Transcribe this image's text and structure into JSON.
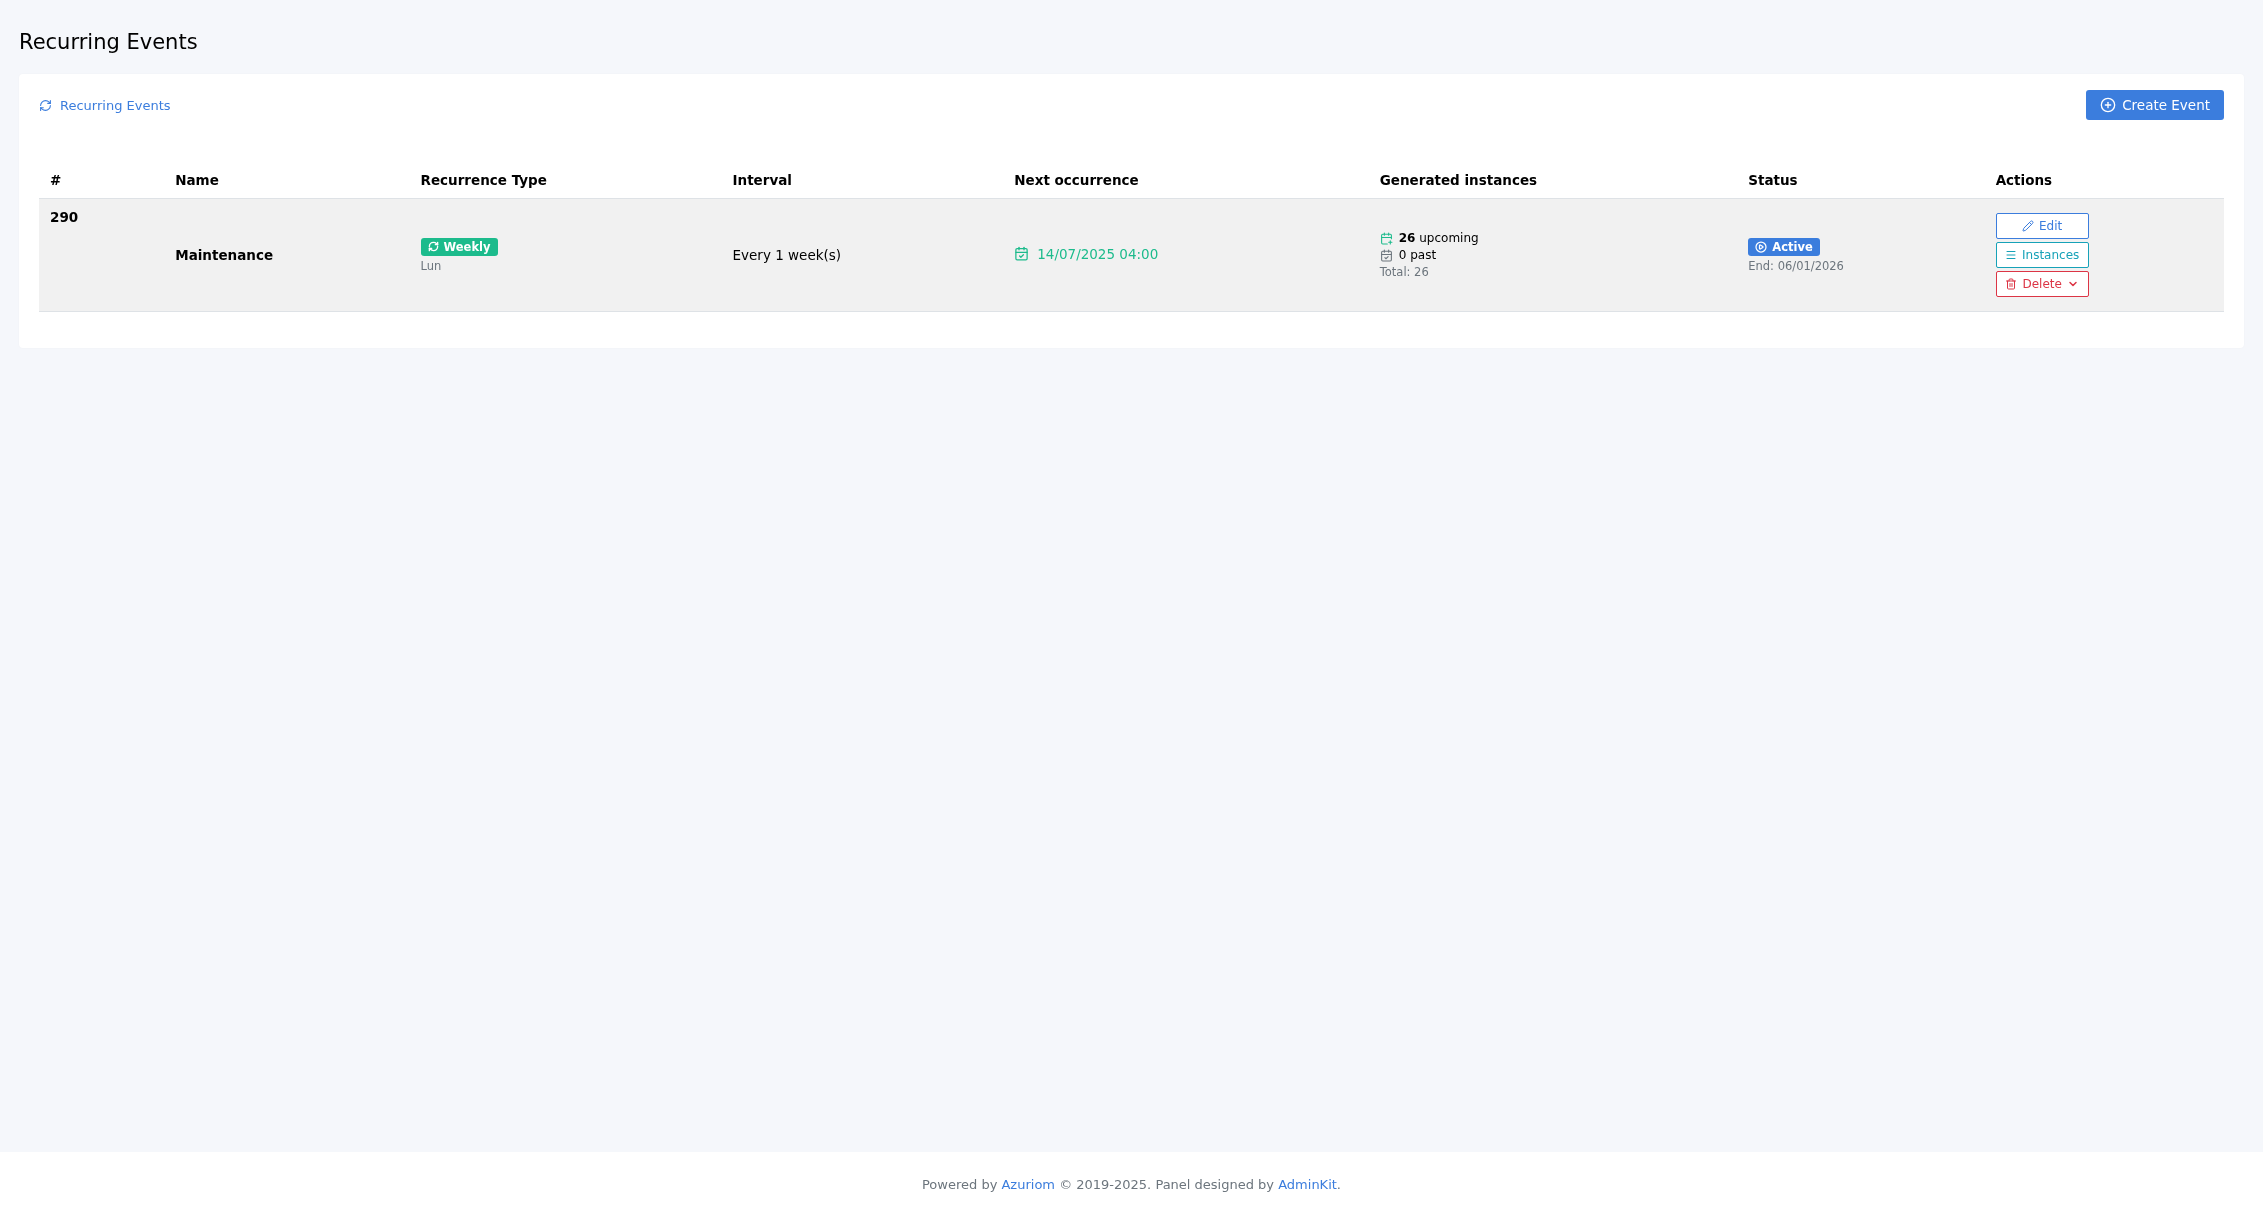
{
  "page_title": "Recurring Events",
  "card": {
    "breadcrumb": "Recurring Events",
    "create_button": "Create Event"
  },
  "table": {
    "columns": [
      "#",
      "Name",
      "Recurrence Type",
      "Interval",
      "Next occurrence",
      "Generated instances",
      "Status",
      "Actions"
    ],
    "rows": [
      {
        "id": "290",
        "name": "Maintenance",
        "recurrence": {
          "label": "Weekly",
          "days": "Lun"
        },
        "interval": "Every 1 week(s)",
        "next_occurrence": "14/07/2025 04:00",
        "instances": {
          "upcoming": "**26** upcoming",
          "past": "0 past",
          "total": "Total: 26"
        },
        "status": {
          "kind": "active",
          "label": "Active",
          "end": "End: 06/01/2026"
        },
        "actions": [
          {
            "kind": "edit",
            "label": "Edit"
          },
          {
            "kind": "instances",
            "label": "Instances"
          },
          {
            "kind": "delete",
            "label": "Delete"
          }
        ]
      }
    ]
  },
  "footer": [
    {
      "kind": "text",
      "text": "Powered by "
    },
    {
      "kind": "link",
      "text": "Azuriom"
    },
    {
      "kind": "text",
      "text": " © 2019-2025. Panel designed by "
    },
    {
      "kind": "link",
      "text": "AdminKit"
    },
    {
      "kind": "text",
      "text": "."
    }
  ]
}
